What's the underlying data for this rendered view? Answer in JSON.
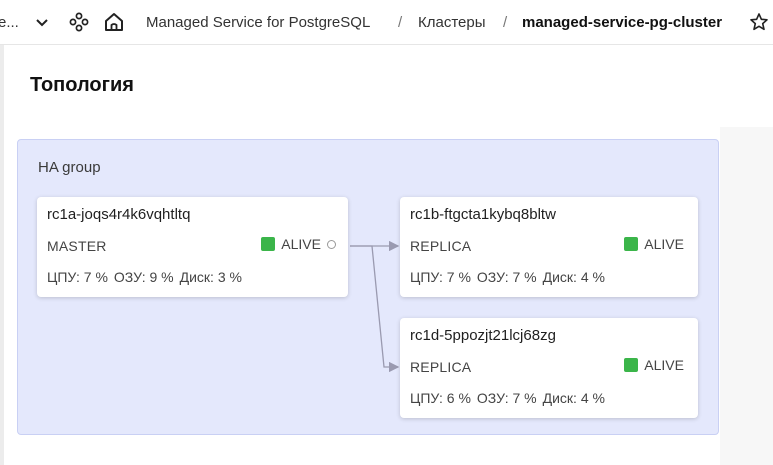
{
  "breadcrumbs": {
    "truncated_left": "e...",
    "service": "Managed Service for PostgreSQL",
    "clusters": "Кластеры",
    "cluster_name": "managed-service-pg-cluster",
    "separator": "/"
  },
  "page": {
    "title": "Топология"
  },
  "group": {
    "title": "HA group"
  },
  "hosts": [
    {
      "name": "rc1a-joqs4r4k6vqhtltq",
      "role": "MASTER",
      "status": "ALIVE",
      "status_color": "#3bb54a",
      "cpu": "ЦПУ: 7 %",
      "ram": "ОЗУ: 9 %",
      "disk": "Диск: 3 %"
    },
    {
      "name": "rc1b-ftgcta1kybq8bltw",
      "role": "REPLICA",
      "status": "ALIVE",
      "status_color": "#3bb54a",
      "cpu": "ЦПУ: 7 %",
      "ram": "ОЗУ: 7 %",
      "disk": "Диск: 4 %"
    },
    {
      "name": "rc1d-5ppozjt21lcj68zg",
      "role": "REPLICA",
      "status": "ALIVE",
      "status_color": "#3bb54a",
      "cpu": "ЦПУ: 6 %",
      "ram": "ОЗУ: 7 %",
      "disk": "Диск: 4 %"
    }
  ],
  "icons": [
    "chevron-down-icon",
    "services-icon",
    "home-icon",
    "star-icon"
  ]
}
